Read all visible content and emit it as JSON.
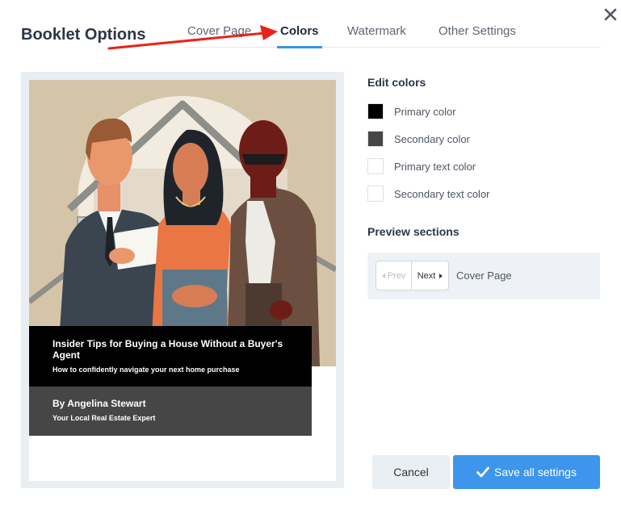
{
  "dialog": {
    "title": "Booklet Options"
  },
  "tabs": [
    {
      "label": "Cover Page",
      "active": false
    },
    {
      "label": "Colors",
      "active": true
    },
    {
      "label": "Watermark",
      "active": false
    },
    {
      "label": "Other Settings",
      "active": false
    }
  ],
  "cover": {
    "title": "Insider Tips for Buying a House Without a Buyer's Agent",
    "subtitle": "How to confidently navigate your next home purchase",
    "author": "By Angelina Stewart",
    "tagline": "Your Local Real Estate Expert"
  },
  "edit_colors": {
    "heading": "Edit colors",
    "items": [
      {
        "label": "Primary color",
        "color": "#000000"
      },
      {
        "label": "Secondary color",
        "color": "#464646"
      },
      {
        "label": "Primary text color",
        "color": "#ffffff"
      },
      {
        "label": "Secondary text color",
        "color": "#ffffff"
      }
    ]
  },
  "preview_sections": {
    "heading": "Preview sections",
    "prev_label": "Prev",
    "next_label": "Next",
    "current_section": "Cover Page"
  },
  "buttons": {
    "cancel": "Cancel",
    "save": "Save all settings"
  },
  "colors": {
    "accent": "#3d95ec",
    "tab_underline": "#3d93e4",
    "annotation_arrow": "#e8231c",
    "panel_bg": "#e9eef3"
  },
  "icons": {
    "close": "close-icon",
    "prev": "caret-left-icon",
    "next": "caret-right-icon",
    "save": "check-icon"
  }
}
